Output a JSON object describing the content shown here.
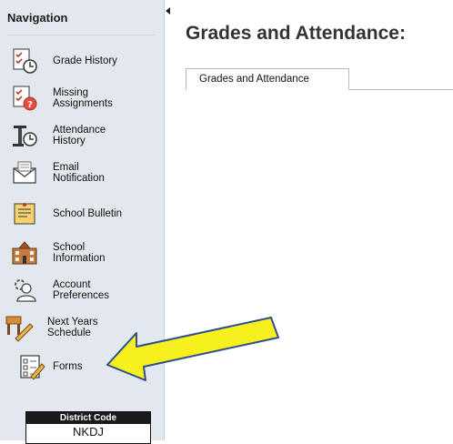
{
  "sidebar": {
    "title": "Navigation",
    "items": [
      {
        "label_lines": [
          "Grade History"
        ],
        "icon": "grade-history-icon"
      },
      {
        "label_lines": [
          "Missing",
          "Assignments"
        ],
        "icon": "missing-assignments-icon"
      },
      {
        "label_lines": [
          "Attendance",
          "History"
        ],
        "icon": "attendance-history-icon"
      },
      {
        "label_lines": [
          "Email",
          "Notification"
        ],
        "icon": "email-icon"
      },
      {
        "label_lines": [
          "School Bulletin"
        ],
        "icon": "bulletin-icon"
      },
      {
        "label_lines": [
          "School",
          "Information"
        ],
        "icon": "school-icon"
      },
      {
        "label_lines": [
          "Account",
          "Preferences"
        ],
        "icon": "account-preferences-icon"
      },
      {
        "label_lines": [
          "Next Years",
          "Schedule"
        ],
        "icon": "schedule-icon"
      },
      {
        "label_lines": [
          "Forms"
        ],
        "icon": "forms-icon"
      }
    ],
    "district": {
      "label": "District Code",
      "value": "NKDJ"
    }
  },
  "main": {
    "title": "Grades and Attendance:",
    "tab_label": "Grades and Attendance"
  },
  "colors": {
    "sidebar_bg": "#e3e8ef",
    "arrow_fill": "#f5f01e",
    "arrow_stroke": "#2f4f8f"
  }
}
